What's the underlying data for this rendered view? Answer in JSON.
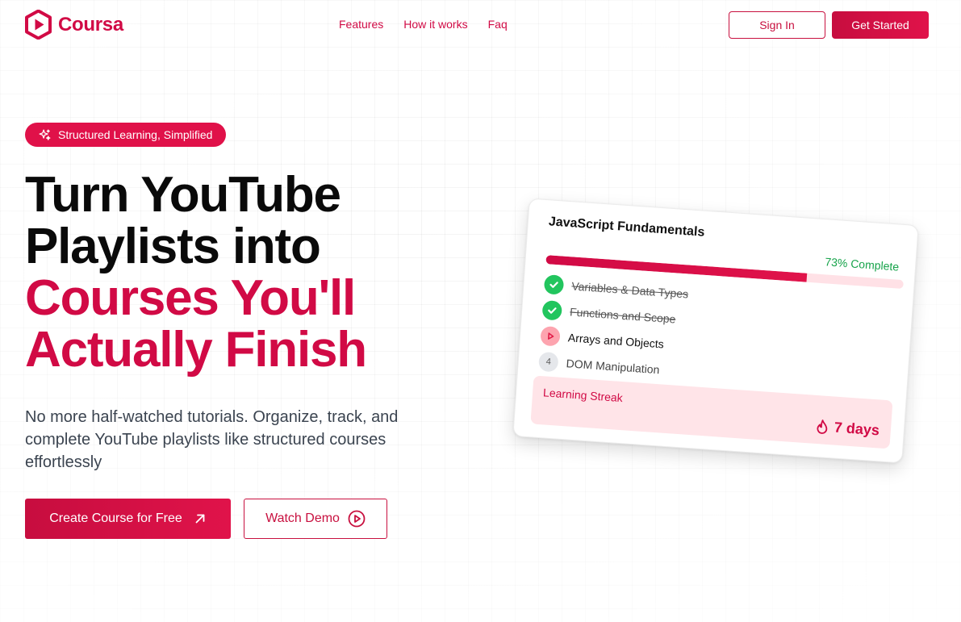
{
  "brand": {
    "name": "Coursa",
    "accent_color": "#d10a45",
    "logo_icon": "play-hexagon-icon"
  },
  "nav": {
    "links": [
      "Features",
      "How it works",
      "Faq"
    ],
    "sign_in": "Sign In",
    "get_started": "Get Started"
  },
  "hero": {
    "badge": "Structured Learning, Simplified",
    "badge_icon": "sparkles-icon",
    "headline_line1": "Turn YouTube",
    "headline_line2": "Playlists into",
    "headline_line3": "Courses You'll",
    "headline_line4": "Actually Finish",
    "subtext": "No more half-watched tutorials. Organize, track, and complete YouTube playlists like structured courses effortlessly",
    "cta_primary": "Create Course for Free",
    "cta_primary_icon": "arrow-up-right-icon",
    "cta_secondary": "Watch Demo",
    "cta_secondary_icon": "play-circle-icon"
  },
  "course_card": {
    "title": "JavaScript Fundamentals",
    "progress_label": "73% Complete",
    "progress_percent": 73,
    "lessons": [
      {
        "title": "Variables & Data Types",
        "status": "done",
        "marker": ""
      },
      {
        "title": "Functions and Scope",
        "status": "done",
        "marker": ""
      },
      {
        "title": "Arrays and Objects",
        "status": "current",
        "marker": ""
      },
      {
        "title": "DOM Manipulation",
        "status": "pending",
        "marker": "4"
      }
    ],
    "streak_label": "Learning Streak",
    "streak_value": "7 days",
    "streak_icon": "flame-icon"
  },
  "colors": {
    "complete_green": "#16a34a",
    "progress_track": "#ffe1e6",
    "streak_bg": "#ffe4e8"
  }
}
